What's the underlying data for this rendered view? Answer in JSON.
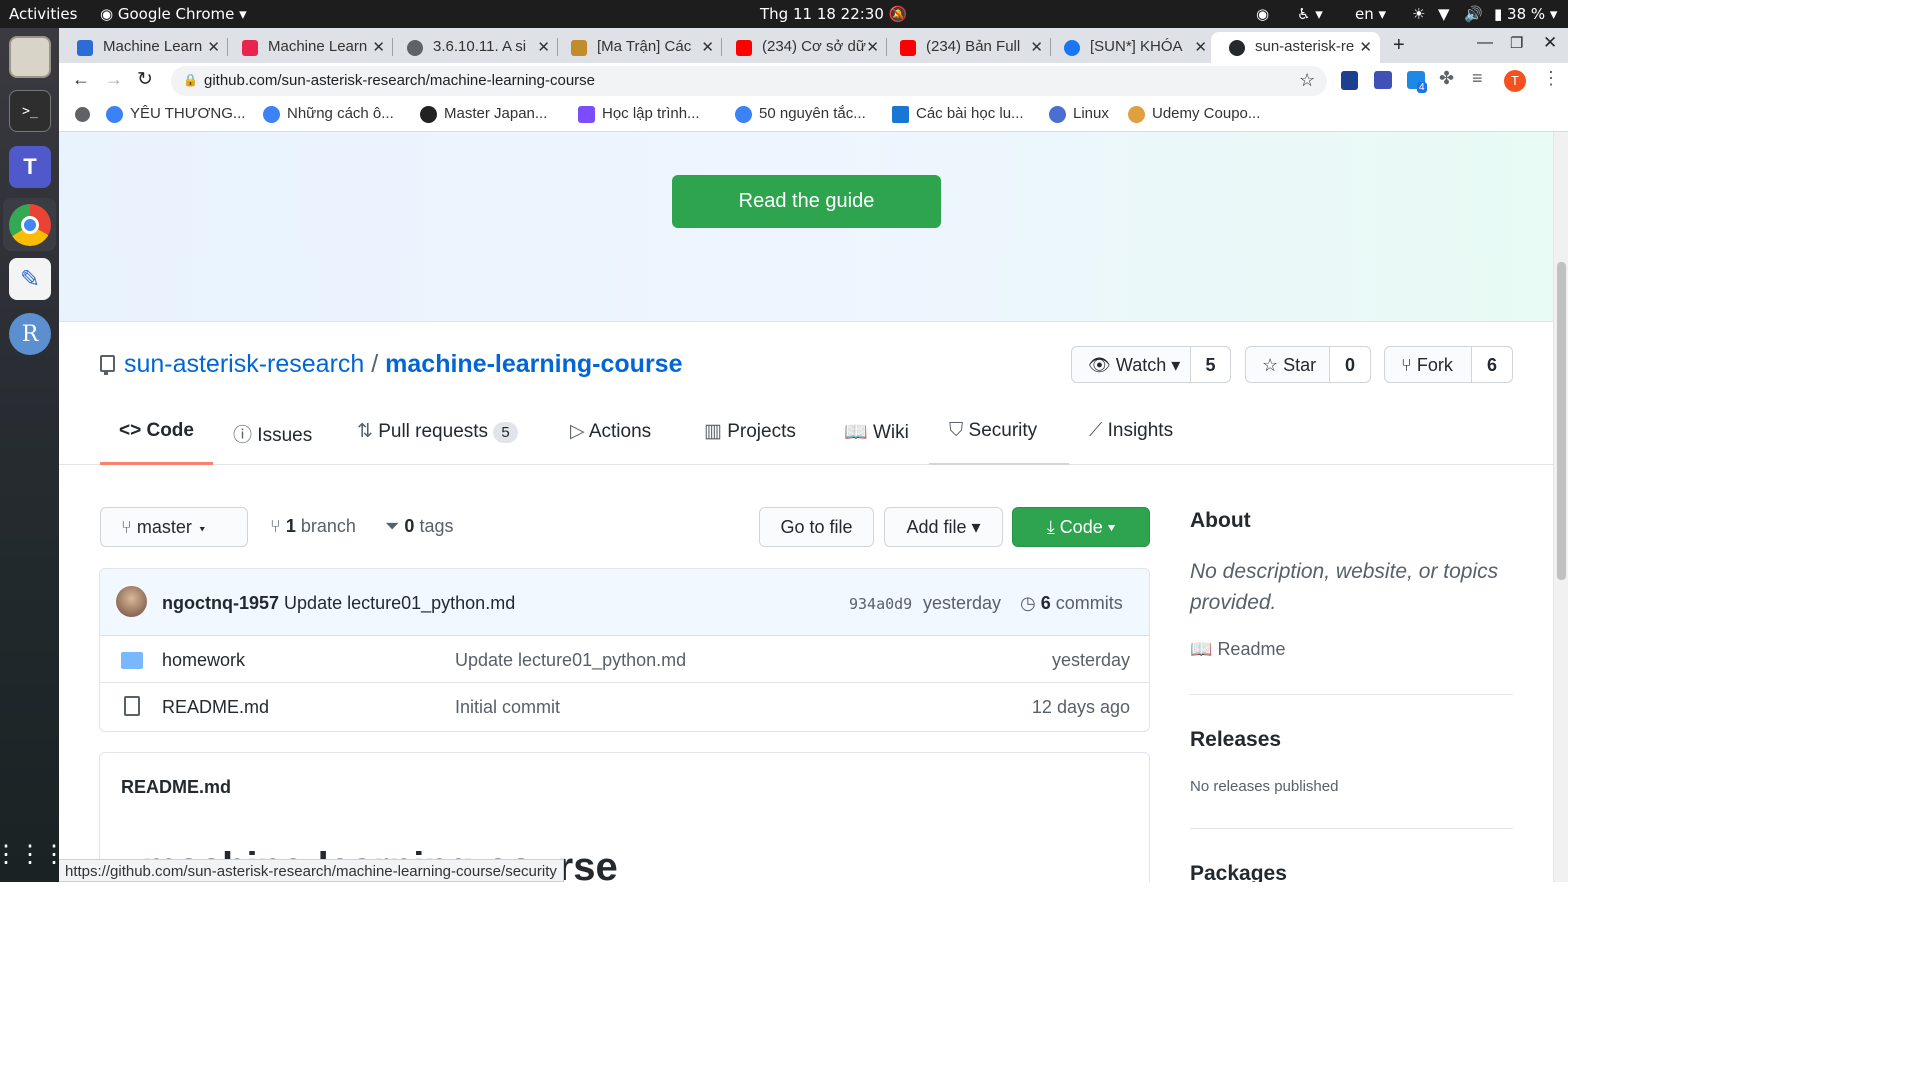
{
  "system_bar": {
    "activities": "Activities",
    "app_name": "Google Chrome",
    "clock": "Thg 11 18  22:30",
    "language": "en",
    "battery": "38 %"
  },
  "tabs": [
    {
      "title": "Machine Learn",
      "favicon_color": "#2b6cd6"
    },
    {
      "title": "Machine Learn",
      "favicon_color": "#e8244f"
    },
    {
      "title": "3.6.10.11. A si",
      "favicon_color": "#5f6368"
    },
    {
      "title": "[Ma Trận] Các",
      "favicon_color": "#c28b2c"
    },
    {
      "title": "(234) Cơ sở dữ",
      "favicon_color": "#ff0000"
    },
    {
      "title": "(234) Bản Full",
      "favicon_color": "#ff0000"
    },
    {
      "title": "[SUN*] KHÓA",
      "favicon_color": "#1877f2"
    },
    {
      "title": "sun-asterisk-re",
      "favicon_color": "#24292e"
    }
  ],
  "address": {
    "url": "github.com/sun-asterisk-research/machine-learning-course"
  },
  "profile_initial": "T",
  "extension_badge": "4",
  "bookmarks": [
    {
      "label": "YÊU THƯƠNG...",
      "color": "#3b82f6"
    },
    {
      "label": "Những cách ô...",
      "color": "#3b82f6"
    },
    {
      "label": "Master Japan...",
      "color": "#222222"
    },
    {
      "label": "Học lập trình...",
      "color": "#7c4dff"
    },
    {
      "label": "50 nguyên tắc...",
      "color": "#3b82f6"
    },
    {
      "label": "Các bài học lu...",
      "color": "#1976d2"
    },
    {
      "label": "Linux",
      "color": "#4a6fd1"
    },
    {
      "label": "Udemy Coupo...",
      "color": "#e0a040"
    }
  ],
  "hero": {
    "button": "Read the guide"
  },
  "repo": {
    "owner": "sun-asterisk-research",
    "separator": "/",
    "name": "machine-learning-course",
    "watch_label": "Watch",
    "watch_count": "5",
    "star_label": "Star",
    "star_count": "0",
    "fork_label": "Fork",
    "fork_count": "6"
  },
  "nav": [
    {
      "label": "Code",
      "icon": "code-icon"
    },
    {
      "label": "Issues",
      "icon": "issue-icon"
    },
    {
      "label": "Pull requests",
      "icon": "pull-request-icon",
      "count": "5"
    },
    {
      "label": "Actions",
      "icon": "play-icon"
    },
    {
      "label": "Projects",
      "icon": "project-icon"
    },
    {
      "label": "Wiki",
      "icon": "book-icon"
    },
    {
      "label": "Security",
      "icon": "shield-icon"
    },
    {
      "label": "Insights",
      "icon": "graph-icon"
    }
  ],
  "toolbar": {
    "branch": "master",
    "branch_count": "1",
    "branch_word": "branch",
    "tag_count": "0",
    "tag_word": "tags",
    "go_to_file": "Go to file",
    "add_file": "Add file",
    "code": "Code"
  },
  "commit": {
    "author": "ngoctnq-1957",
    "message": "Update lecture01_python.md",
    "sha": "934a0d9",
    "time": "yesterday",
    "commit_count": "6",
    "commit_word": "commits"
  },
  "files": [
    {
      "type": "folder",
      "name": "homework",
      "message": "Update lecture01_python.md",
      "time": "yesterday"
    },
    {
      "type": "file",
      "name": "README.md",
      "message": "Initial commit",
      "time": "12 days ago"
    }
  ],
  "readme": {
    "filename": "README.md",
    "heading": "machine-learning-course"
  },
  "about": {
    "title": "About",
    "description": "No description, website, or topics provided.",
    "readme_link": "Readme",
    "releases_title": "Releases",
    "releases_text": "No releases published",
    "packages_title": "Packages"
  },
  "status_url": "https://github.com/sun-asterisk-research/machine-learning-course/security",
  "colors": {
    "green": "#2ea44f",
    "link": "#0366d6",
    "active_tab_underline": "#f9826c"
  }
}
